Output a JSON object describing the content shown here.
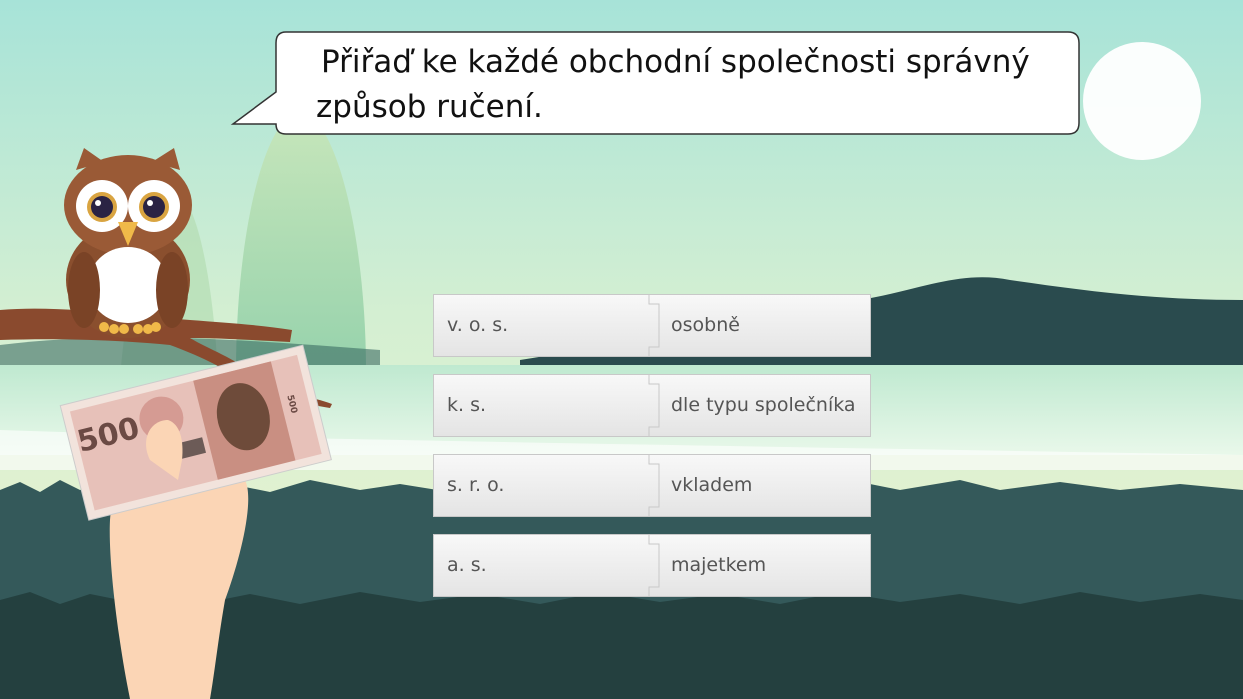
{
  "instruction": {
    "line1": "Přiřaď ke každé obchodní společnosti správný",
    "line2": "způsob ručení."
  },
  "pairs": [
    {
      "left": "v. o. s.",
      "right": "osobně"
    },
    {
      "left": "k. s.",
      "right": "dle typu společníka"
    },
    {
      "left": "s. r. o.",
      "right": "vkladem"
    },
    {
      "left": "a. s.",
      "right": "majetkem"
    }
  ],
  "banknote": {
    "value": "500",
    "small_value": "500"
  },
  "colors": {
    "sky_top": "#a7e3d8",
    "sky_bottom": "#e7f2c8",
    "hill": "#2a4b4e",
    "water": "#d6f2e4",
    "card_face": "#f3f3f3",
    "card_border": "#c8c8c8",
    "label_text": "#555555",
    "owl_brown": "#8a4f2e"
  },
  "icons": {
    "owl": "owl-mascot",
    "hand": "hand-holding-banknote",
    "sun": "sun"
  }
}
